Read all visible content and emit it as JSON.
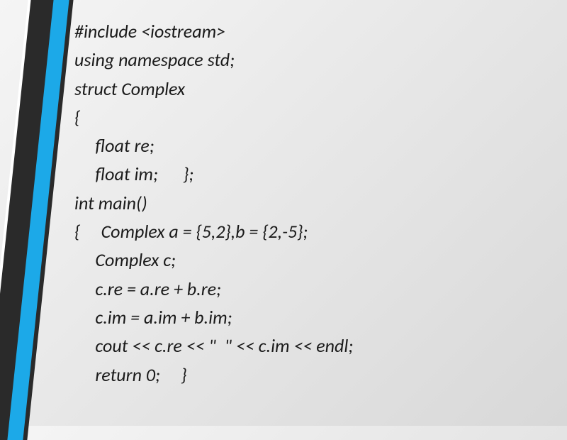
{
  "code": {
    "lines": [
      "#include <iostream>",
      "using namespace std;",
      "struct Complex",
      "{",
      "     float re;",
      "     float im;      };",
      "int main()",
      "{     Complex a = {5,2},b = {2,-5};",
      "     Complex c;",
      "     c.re = a.re + b.re;",
      "     c.im = a.im + b.im;",
      "     cout << c.re << \"  \" << c.im << endl;",
      "     return 0;     }"
    ]
  },
  "colors": {
    "stripe_blue": "#1ca9e8",
    "stripe_dark": "#2a2a2a"
  }
}
